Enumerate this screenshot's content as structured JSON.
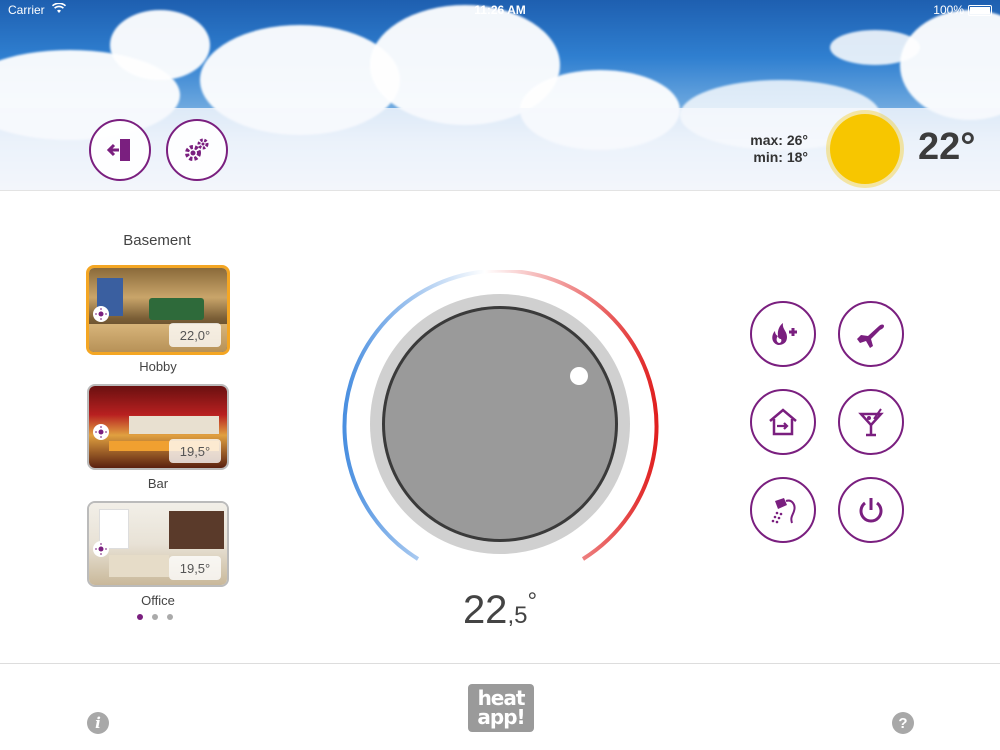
{
  "status_bar": {
    "carrier": "Carrier",
    "time": "11:26 AM",
    "battery": "100%"
  },
  "header": {
    "buttons": [
      {
        "icon": "exit-door-icon"
      },
      {
        "icon": "gears-icon"
      }
    ],
    "weather": {
      "max": "max: 26°",
      "min": "min: 18°",
      "temp": "22°",
      "icon": "sun-icon"
    }
  },
  "rooms": {
    "group_title": "Basement",
    "items": [
      {
        "label": "Hobby",
        "temp": "22,0°",
        "active": true
      },
      {
        "label": "Bar",
        "temp": "19,5°",
        "active": false
      },
      {
        "label": "Office",
        "temp": "19,5°",
        "active": false
      }
    ],
    "page_indicator": {
      "pages": 3,
      "current": 1
    }
  },
  "thermostat": {
    "whole": "22",
    "fraction": ",5",
    "unit": "°"
  },
  "modes": [
    {
      "icon": "flame-plus-icon"
    },
    {
      "icon": "airplane-icon"
    },
    {
      "icon": "home-arrive-icon"
    },
    {
      "icon": "cocktail-icon"
    },
    {
      "icon": "shower-icon"
    },
    {
      "icon": "power-icon"
    }
  ],
  "footer": {
    "info": "i",
    "help": "?",
    "logo_line1": "heat",
    "logo_line2": "app!"
  },
  "colors": {
    "accent": "#7a1f7f",
    "active_room": "#f4a623",
    "sun": "#f7c600",
    "dial_cold": "#4a8fe0",
    "dial_hot": "#e02020"
  }
}
